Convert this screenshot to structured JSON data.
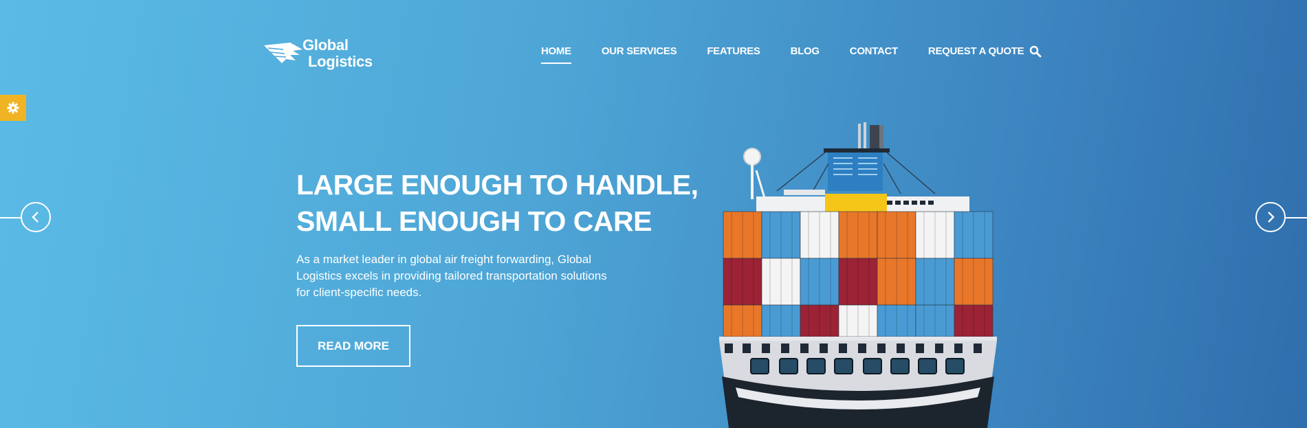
{
  "brand": {
    "line1": "Global",
    "line2": "Logistics"
  },
  "nav": {
    "items": [
      {
        "label": "HOME",
        "active": true
      },
      {
        "label": "OUR SERVICES",
        "active": false
      },
      {
        "label": "FEATURES",
        "active": false
      },
      {
        "label": "BLOG",
        "active": false
      },
      {
        "label": "CONTACT",
        "active": false
      },
      {
        "label": "REQUEST A QUOTE",
        "active": false
      }
    ],
    "search_icon": "search-icon"
  },
  "hero": {
    "headline_line1": "LARGE ENOUGH TO HANDLE,",
    "headline_line2": "SMALL ENOUGH TO CARE",
    "description": "As a market leader in global air freight forwarding, Global Logistics excels in providing tailored transportation solutions for client-specific needs.",
    "cta": "READ MORE"
  },
  "controls": {
    "prev_icon": "chevron-left-icon",
    "next_icon": "chevron-right-icon",
    "settings_icon": "gear-icon"
  },
  "colors": {
    "bg_start": "#5bbbe6",
    "bg_end": "#2f6eac",
    "accent": "#f0b323",
    "container_orange": "#e8772a",
    "container_blue": "#4a9bd4",
    "container_white": "#f4f4f4",
    "container_red": "#9b2335"
  }
}
